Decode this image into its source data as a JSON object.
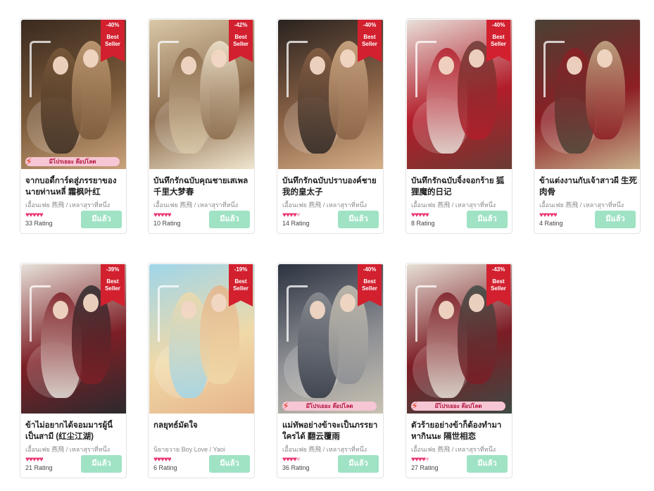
{
  "common": {
    "best_seller_line1": "Best",
    "best_seller_line2": "Seller",
    "promo_label": "มีโปรเยอะ ล๊อปโลต",
    "button_label": "มีแล้ว"
  },
  "books": [
    {
      "title": "จากบอดี้การ์ดสู่ภรรยาของนายท่านหลี่ 霜枫叶红",
      "meta": "เอื้อนเฟย 燕飛 / เหลาสุราที่หนึ่ง",
      "discount": "-40%",
      "rating_count": "33 Rating",
      "hearts": 5,
      "promo": true,
      "palette": [
        "#3a2a1f",
        "#7b5a3a",
        "#c9a27a"
      ]
    },
    {
      "title": "บันทึกรักฉบับคุณชายเสเพล 千里大梦春",
      "meta": "เอื้อนเฟย 燕飛 / เหลาสุราที่หนึ่ง",
      "discount": "-42%",
      "rating_count": "10 Rating",
      "hearts": 5,
      "promo": false,
      "palette": [
        "#d9c8a8",
        "#8a6a4a",
        "#f1e6d0"
      ]
    },
    {
      "title": "บันทึกรักฉบับปราบองค์ชาย 我的皇太子",
      "meta": "เอื้อนเฟย 燕飛 / เหลาสุราที่หนึ่ง",
      "discount": "-40%",
      "rating_count": "14 Rating",
      "hearts": 4,
      "promo": false,
      "palette": [
        "#2a2320",
        "#8a6246",
        "#d6b089"
      ]
    },
    {
      "title": "บันทึกรักฉบับจิ้งจอกร้าย 狐狸魔的日记",
      "meta": "เอื้อนเฟย 燕飛 / เหลาสุราที่หนึ่ง",
      "discount": "-40%",
      "rating_count": "8 Rating",
      "hearts": 5,
      "promo": false,
      "palette": [
        "#e8e0da",
        "#b21d2a",
        "#6a3b33"
      ]
    },
    {
      "title": "ข้าแต่งงานกับเจ้าสาวผี 生死肉骨",
      "meta": "เอื้อนเฟย 燕飛 / เหลาสุราที่หนึ่ง",
      "discount": "",
      "rating_count": "4 Rating",
      "hearts": 5,
      "promo": false,
      "palette": [
        "#4a4134",
        "#8c1e24",
        "#c7b08a"
      ]
    },
    {
      "title": "ข้าไม่อยากได้จอมมารผู้นี้เป็นสามี (红尘江湖)",
      "meta": "เอื้อนเฟย 燕飛 / เหลาสุราที่หนึ่ง",
      "discount": "-39%",
      "rating_count": "21 Rating",
      "hearts": 5,
      "promo": false,
      "palette": [
        "#e7e1da",
        "#7d1f25",
        "#2b2a2e"
      ]
    },
    {
      "title": "กลยุทธ์มัดใจ",
      "meta": "นิยายวาย Boy Love / Yaoi",
      "discount": "-19%",
      "rating_count": "6 Rating",
      "hearts": 5,
      "promo": false,
      "palette": [
        "#9fd6ea",
        "#f0d9a8",
        "#e6b48a"
      ]
    },
    {
      "title": "แม่ทัพอย่างข้าจะเป็นภรรยาใครได้ 翻云覆雨",
      "meta": "เอื้อนเฟย 燕飛 / เหลาสุราที่หนึ่ง",
      "discount": "-40%",
      "rating_count": "36 Rating",
      "hearts": 4,
      "promo": true,
      "palette": [
        "#2c3340",
        "#8d8f94",
        "#c9c2b2"
      ]
    },
    {
      "title": "ตัวร้ายอย่างข้าก็ต้องทำมาหากินนะ 隔世相恋",
      "meta": "เอื้อนเฟย 燕飛 / เหลาสุราที่หนึ่ง",
      "discount": "-43%",
      "rating_count": "27 Rating",
      "hearts": 4,
      "promo": true,
      "palette": [
        "#e6e0d6",
        "#7c1c24",
        "#3d4a44"
      ]
    }
  ]
}
